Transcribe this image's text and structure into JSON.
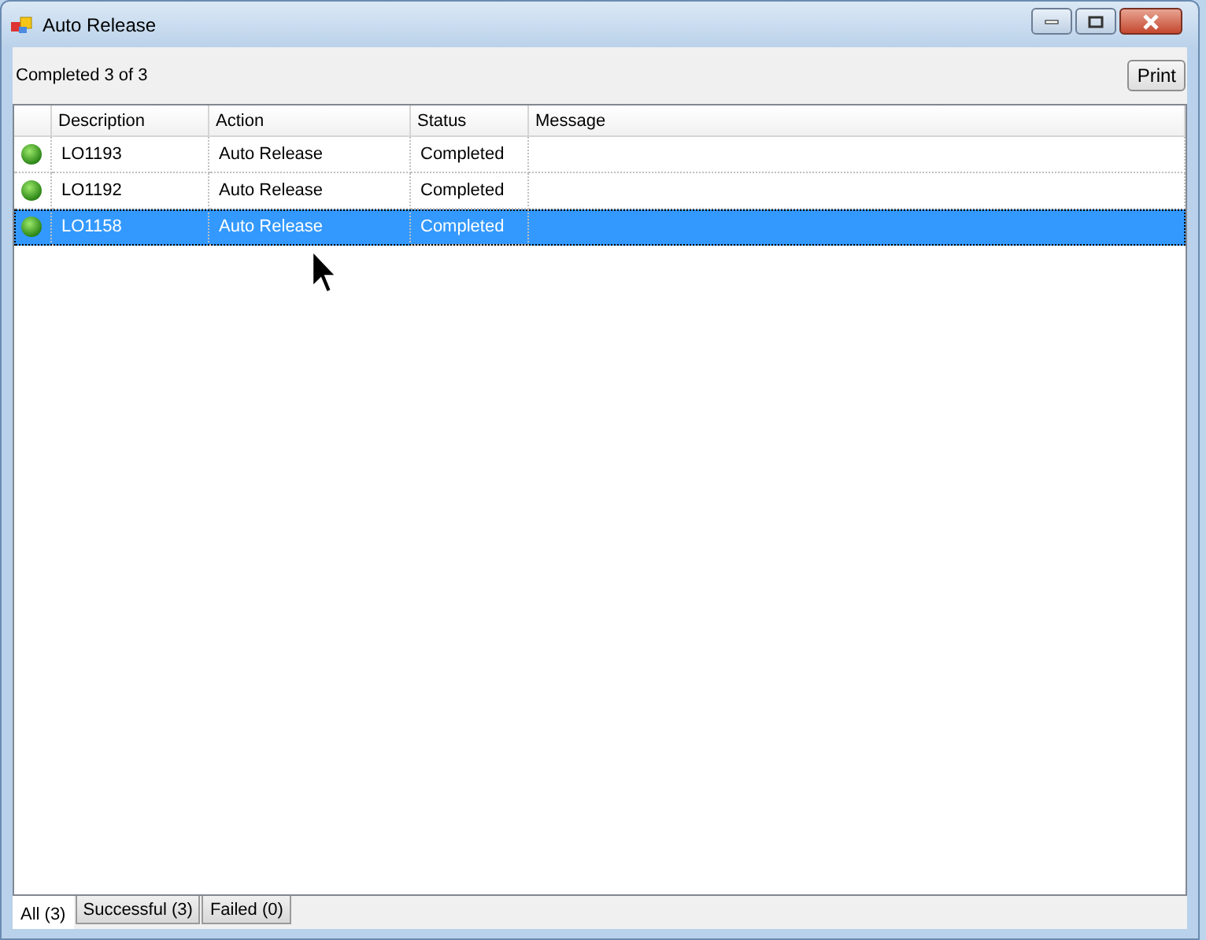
{
  "window": {
    "title": "Auto Release"
  },
  "summary": "Completed 3 of 3",
  "print_button": "Print",
  "table": {
    "columns": [
      "Description",
      "Action",
      "Status",
      "Message"
    ],
    "rows": [
      {
        "cells": [
          "LO1193",
          "Auto Release",
          "Completed",
          ""
        ],
        "selected": false
      },
      {
        "cells": [
          "LO1192",
          "Auto Release",
          "Completed",
          ""
        ],
        "selected": false
      },
      {
        "cells": [
          "LO1158",
          "Auto Release",
          "Completed",
          ""
        ],
        "selected": true
      }
    ]
  },
  "tabs": [
    {
      "label": "All (3)",
      "selected": true
    },
    {
      "label": "Successful (3)",
      "selected": false
    },
    {
      "label": "Failed (0)",
      "selected": false
    }
  ]
}
